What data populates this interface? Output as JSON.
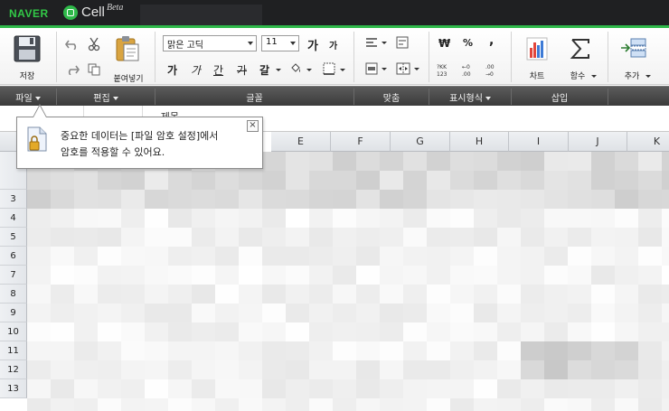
{
  "topbar": {
    "naver": "NAVER",
    "app_name": "Cell",
    "app_badge": "Beta"
  },
  "ribbon": {
    "save_label": "저장",
    "paste_label": "붙여넣기",
    "font_name": "맑은 고딕",
    "font_size": "11",
    "grow_glyph": "가",
    "shrink_glyph": "가",
    "bold_glyph": "가",
    "italic_glyph": "가",
    "underline_glyph": "간",
    "strike_glyph": "가",
    "fontcolor_glyph": "갈",
    "currency_glyph": "₩",
    "percent_glyph": "%",
    "comma_glyph": ",",
    "chart_label": "차트",
    "function_label": "함수",
    "add_label": "추가"
  },
  "groups": {
    "file": "파일",
    "edit": "편집",
    "font": "글꼴",
    "align": "맞춤",
    "number_format": "표시형식",
    "insert": "삽입"
  },
  "formula": {
    "value": "~ 제목"
  },
  "columns": [
    "E",
    "F",
    "G",
    "H",
    "I",
    "J",
    "K"
  ],
  "rows": [
    "3",
    "4",
    "5",
    "6",
    "7",
    "8",
    "9",
    "10",
    "11",
    "12",
    "13"
  ],
  "tooltip": {
    "line1": "중요한 데이터는 [파일 암호 설정]에서",
    "line2": "암호를 적용할 수 있어요.",
    "close": "×"
  },
  "colors": {
    "brand_green": "#2fb94a",
    "topbar": "#1f2022",
    "groupbar": "#474747"
  }
}
